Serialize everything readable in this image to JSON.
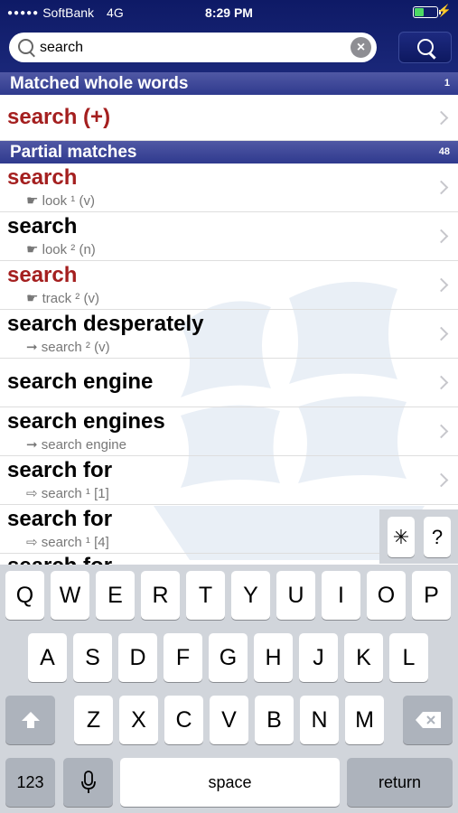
{
  "status_bar": {
    "signal_dots": "●●●●●",
    "carrier": "SoftBank",
    "network": "4G",
    "time": "8:29 PM",
    "battery_level": 0.45
  },
  "search": {
    "value": "search",
    "clear_icon": "clear-icon",
    "search_icon": "search-icon"
  },
  "sections": {
    "whole": {
      "title": "Matched whole words",
      "count": "1"
    },
    "partial": {
      "title": "Partial matches",
      "count": "48"
    }
  },
  "whole_rows": [
    {
      "word": "search (+)",
      "sub": ""
    }
  ],
  "partial_rows": [
    {
      "word": "search",
      "sub": "☛ look ¹ (v)"
    },
    {
      "word": "search",
      "sub": "☛ look ² (n)"
    },
    {
      "word": "search",
      "sub": "☛ track ² (v)"
    },
    {
      "word": "search desperately",
      "sub": "➞ search ² (v)"
    },
    {
      "word": "search engine",
      "sub": ""
    },
    {
      "word": "search engines",
      "sub": "➞ search engine"
    },
    {
      "word": "search for",
      "sub": "⇨ search ¹ [1]"
    },
    {
      "word": "search for",
      "sub": "⇨ search ¹ [4]"
    },
    {
      "word": "search for",
      "sub": ""
    }
  ],
  "side_keys": [
    "✳",
    "?"
  ],
  "keyboard": {
    "row1": [
      "Q",
      "W",
      "E",
      "R",
      "T",
      "Y",
      "U",
      "I",
      "O",
      "P"
    ],
    "row2": [
      "A",
      "S",
      "D",
      "F",
      "G",
      "H",
      "J",
      "K",
      "L"
    ],
    "row3": [
      "Z",
      "X",
      "C",
      "V",
      "B",
      "N",
      "M"
    ],
    "numbers": "123",
    "space": "space",
    "return": "return"
  },
  "colors": {
    "header_navy": "#1a2779",
    "section_blue": "#3b4592",
    "red_word": "#a41f1f"
  }
}
